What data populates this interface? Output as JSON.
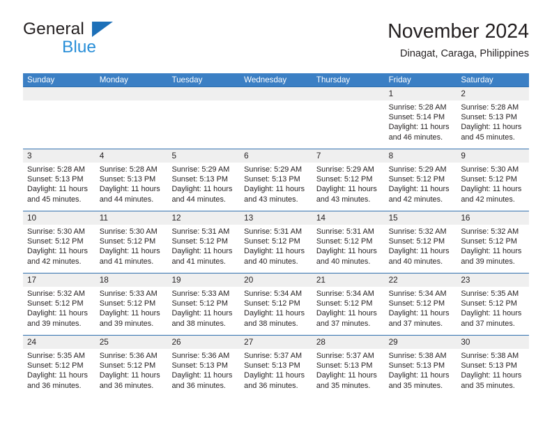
{
  "brand": {
    "name_part1": "General",
    "name_part2": "Blue",
    "triangle_color": "#1d70b8",
    "blue_color": "#2a8fd8"
  },
  "header": {
    "title": "November 2024",
    "subtitle": "Dinagat, Caraga, Philippines"
  },
  "theme": {
    "header_bg": "#3b7fc4",
    "cell_border": "#2f6fae",
    "day_band_bg": "#efefef",
    "text": "#231f20"
  },
  "weekdays": [
    "Sunday",
    "Monday",
    "Tuesday",
    "Wednesday",
    "Thursday",
    "Friday",
    "Saturday"
  ],
  "weeks": [
    [
      {
        "day": "",
        "sunrise": "",
        "sunset": "",
        "daylight1": "",
        "daylight2": ""
      },
      {
        "day": "",
        "sunrise": "",
        "sunset": "",
        "daylight1": "",
        "daylight2": ""
      },
      {
        "day": "",
        "sunrise": "",
        "sunset": "",
        "daylight1": "",
        "daylight2": ""
      },
      {
        "day": "",
        "sunrise": "",
        "sunset": "",
        "daylight1": "",
        "daylight2": ""
      },
      {
        "day": "",
        "sunrise": "",
        "sunset": "",
        "daylight1": "",
        "daylight2": ""
      },
      {
        "day": "1",
        "sunrise": "Sunrise: 5:28 AM",
        "sunset": "Sunset: 5:14 PM",
        "daylight1": "Daylight: 11 hours",
        "daylight2": "and 46 minutes."
      },
      {
        "day": "2",
        "sunrise": "Sunrise: 5:28 AM",
        "sunset": "Sunset: 5:13 PM",
        "daylight1": "Daylight: 11 hours",
        "daylight2": "and 45 minutes."
      }
    ],
    [
      {
        "day": "3",
        "sunrise": "Sunrise: 5:28 AM",
        "sunset": "Sunset: 5:13 PM",
        "daylight1": "Daylight: 11 hours",
        "daylight2": "and 45 minutes."
      },
      {
        "day": "4",
        "sunrise": "Sunrise: 5:28 AM",
        "sunset": "Sunset: 5:13 PM",
        "daylight1": "Daylight: 11 hours",
        "daylight2": "and 44 minutes."
      },
      {
        "day": "5",
        "sunrise": "Sunrise: 5:29 AM",
        "sunset": "Sunset: 5:13 PM",
        "daylight1": "Daylight: 11 hours",
        "daylight2": "and 44 minutes."
      },
      {
        "day": "6",
        "sunrise": "Sunrise: 5:29 AM",
        "sunset": "Sunset: 5:13 PM",
        "daylight1": "Daylight: 11 hours",
        "daylight2": "and 43 minutes."
      },
      {
        "day": "7",
        "sunrise": "Sunrise: 5:29 AM",
        "sunset": "Sunset: 5:12 PM",
        "daylight1": "Daylight: 11 hours",
        "daylight2": "and 43 minutes."
      },
      {
        "day": "8",
        "sunrise": "Sunrise: 5:29 AM",
        "sunset": "Sunset: 5:12 PM",
        "daylight1": "Daylight: 11 hours",
        "daylight2": "and 42 minutes."
      },
      {
        "day": "9",
        "sunrise": "Sunrise: 5:30 AM",
        "sunset": "Sunset: 5:12 PM",
        "daylight1": "Daylight: 11 hours",
        "daylight2": "and 42 minutes."
      }
    ],
    [
      {
        "day": "10",
        "sunrise": "Sunrise: 5:30 AM",
        "sunset": "Sunset: 5:12 PM",
        "daylight1": "Daylight: 11 hours",
        "daylight2": "and 42 minutes."
      },
      {
        "day": "11",
        "sunrise": "Sunrise: 5:30 AM",
        "sunset": "Sunset: 5:12 PM",
        "daylight1": "Daylight: 11 hours",
        "daylight2": "and 41 minutes."
      },
      {
        "day": "12",
        "sunrise": "Sunrise: 5:31 AM",
        "sunset": "Sunset: 5:12 PM",
        "daylight1": "Daylight: 11 hours",
        "daylight2": "and 41 minutes."
      },
      {
        "day": "13",
        "sunrise": "Sunrise: 5:31 AM",
        "sunset": "Sunset: 5:12 PM",
        "daylight1": "Daylight: 11 hours",
        "daylight2": "and 40 minutes."
      },
      {
        "day": "14",
        "sunrise": "Sunrise: 5:31 AM",
        "sunset": "Sunset: 5:12 PM",
        "daylight1": "Daylight: 11 hours",
        "daylight2": "and 40 minutes."
      },
      {
        "day": "15",
        "sunrise": "Sunrise: 5:32 AM",
        "sunset": "Sunset: 5:12 PM",
        "daylight1": "Daylight: 11 hours",
        "daylight2": "and 40 minutes."
      },
      {
        "day": "16",
        "sunrise": "Sunrise: 5:32 AM",
        "sunset": "Sunset: 5:12 PM",
        "daylight1": "Daylight: 11 hours",
        "daylight2": "and 39 minutes."
      }
    ],
    [
      {
        "day": "17",
        "sunrise": "Sunrise: 5:32 AM",
        "sunset": "Sunset: 5:12 PM",
        "daylight1": "Daylight: 11 hours",
        "daylight2": "and 39 minutes."
      },
      {
        "day": "18",
        "sunrise": "Sunrise: 5:33 AM",
        "sunset": "Sunset: 5:12 PM",
        "daylight1": "Daylight: 11 hours",
        "daylight2": "and 39 minutes."
      },
      {
        "day": "19",
        "sunrise": "Sunrise: 5:33 AM",
        "sunset": "Sunset: 5:12 PM",
        "daylight1": "Daylight: 11 hours",
        "daylight2": "and 38 minutes."
      },
      {
        "day": "20",
        "sunrise": "Sunrise: 5:34 AM",
        "sunset": "Sunset: 5:12 PM",
        "daylight1": "Daylight: 11 hours",
        "daylight2": "and 38 minutes."
      },
      {
        "day": "21",
        "sunrise": "Sunrise: 5:34 AM",
        "sunset": "Sunset: 5:12 PM",
        "daylight1": "Daylight: 11 hours",
        "daylight2": "and 37 minutes."
      },
      {
        "day": "22",
        "sunrise": "Sunrise: 5:34 AM",
        "sunset": "Sunset: 5:12 PM",
        "daylight1": "Daylight: 11 hours",
        "daylight2": "and 37 minutes."
      },
      {
        "day": "23",
        "sunrise": "Sunrise: 5:35 AM",
        "sunset": "Sunset: 5:12 PM",
        "daylight1": "Daylight: 11 hours",
        "daylight2": "and 37 minutes."
      }
    ],
    [
      {
        "day": "24",
        "sunrise": "Sunrise: 5:35 AM",
        "sunset": "Sunset: 5:12 PM",
        "daylight1": "Daylight: 11 hours",
        "daylight2": "and 36 minutes."
      },
      {
        "day": "25",
        "sunrise": "Sunrise: 5:36 AM",
        "sunset": "Sunset: 5:12 PM",
        "daylight1": "Daylight: 11 hours",
        "daylight2": "and 36 minutes."
      },
      {
        "day": "26",
        "sunrise": "Sunrise: 5:36 AM",
        "sunset": "Sunset: 5:13 PM",
        "daylight1": "Daylight: 11 hours",
        "daylight2": "and 36 minutes."
      },
      {
        "day": "27",
        "sunrise": "Sunrise: 5:37 AM",
        "sunset": "Sunset: 5:13 PM",
        "daylight1": "Daylight: 11 hours",
        "daylight2": "and 36 minutes."
      },
      {
        "day": "28",
        "sunrise": "Sunrise: 5:37 AM",
        "sunset": "Sunset: 5:13 PM",
        "daylight1": "Daylight: 11 hours",
        "daylight2": "and 35 minutes."
      },
      {
        "day": "29",
        "sunrise": "Sunrise: 5:38 AM",
        "sunset": "Sunset: 5:13 PM",
        "daylight1": "Daylight: 11 hours",
        "daylight2": "and 35 minutes."
      },
      {
        "day": "30",
        "sunrise": "Sunrise: 5:38 AM",
        "sunset": "Sunset: 5:13 PM",
        "daylight1": "Daylight: 11 hours",
        "daylight2": "and 35 minutes."
      }
    ]
  ]
}
